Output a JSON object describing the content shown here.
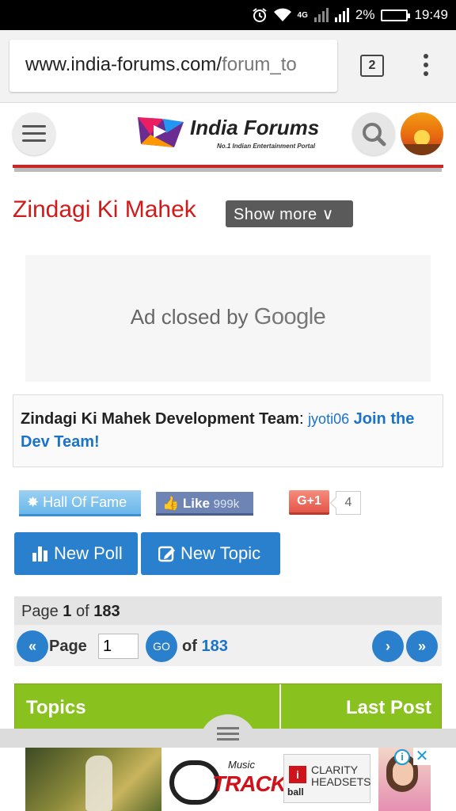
{
  "status_bar": {
    "network_label": "4G",
    "battery": "2%",
    "time": "19:49"
  },
  "browser": {
    "url_host": "www.india-forums.com/",
    "url_path": "forum_to",
    "tab_count": "2"
  },
  "site": {
    "logo_name": "India Forums",
    "logo_tagline": "No.1 Indian Entertainment Portal"
  },
  "forum": {
    "title": "Zindagi Ki Mahek",
    "show_more": "Show more ∨"
  },
  "ad": {
    "closed_text": "Ad closed by",
    "brand": "Google"
  },
  "dev_team": {
    "label": "Zindagi Ki Mahek Development Team",
    "separator": ":",
    "member": "jyoti06",
    "join_link": "Join the Dev Team!"
  },
  "social": {
    "hall_of_fame": "Hall Of Fame",
    "fb_like": "Like",
    "fb_count": "999k",
    "gplus": "G+1",
    "gplus_count": "4"
  },
  "actions": {
    "new_poll": "New Poll",
    "new_topic": "New Topic"
  },
  "pagination": {
    "page_word": "Page",
    "current": "1",
    "of_word": "of",
    "total": "183",
    "input_value": "1",
    "go": "GO"
  },
  "table_header": {
    "topics": "Topics",
    "last_post": "Last Post"
  },
  "bottom_ad": {
    "music_word": "Music",
    "track_word": "TRACK",
    "box_brand": "ball",
    "box_line1": "CLARITY",
    "box_line2": "HEADSETS",
    "info_icon": "i",
    "close_icon": "✕"
  },
  "colors": {
    "forum_title": "#d11a1a",
    "button_blue": "#2a80cc",
    "topics_green": "#89c11e",
    "link_blue": "#1a73c9"
  }
}
